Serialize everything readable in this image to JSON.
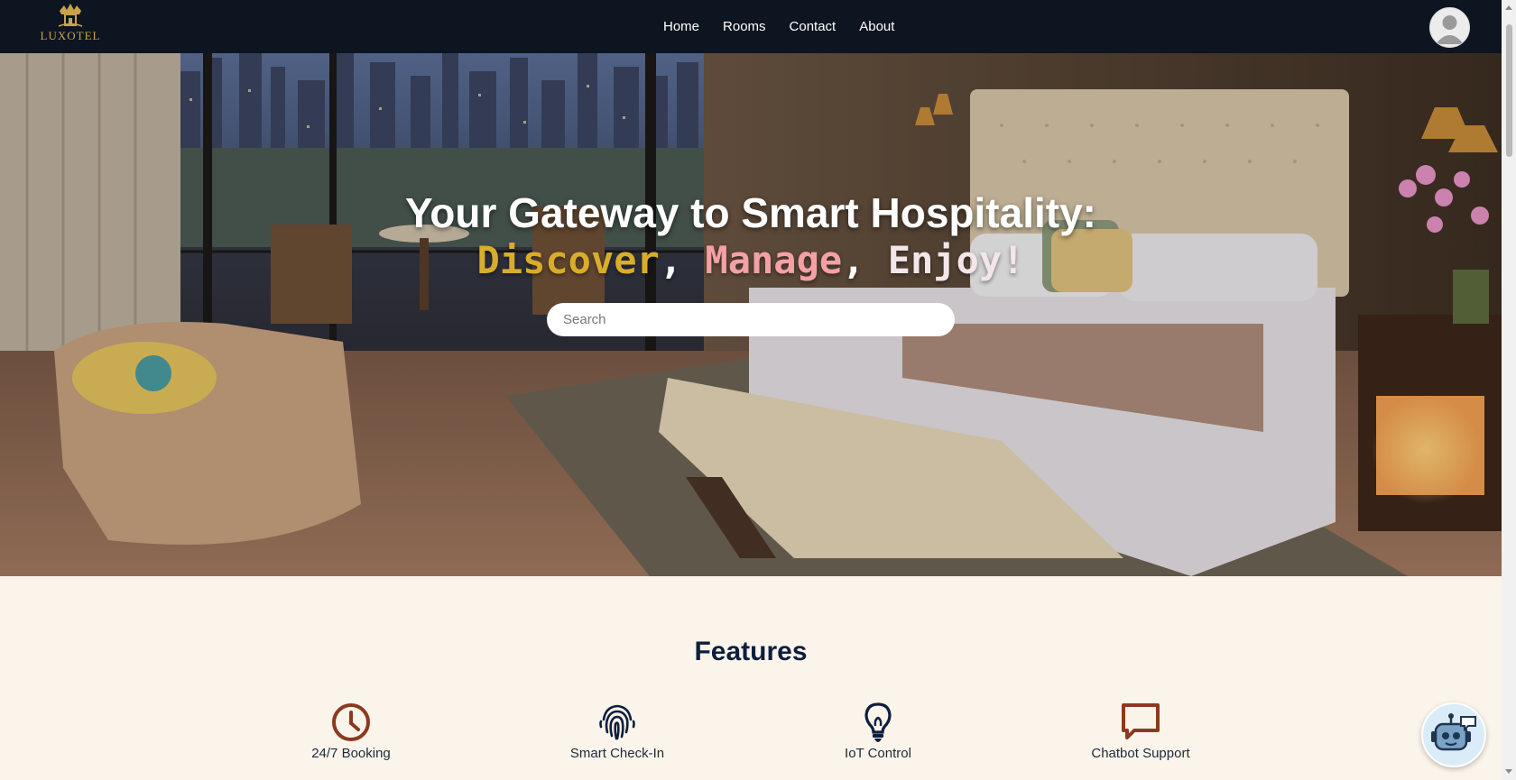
{
  "brand": {
    "name": "LUXOTEL",
    "logo_icon": "crown-hotel-icon"
  },
  "nav": {
    "items": [
      {
        "label": "Home"
      },
      {
        "label": "Rooms"
      },
      {
        "label": "Contact"
      },
      {
        "label": "About"
      }
    ]
  },
  "user": {
    "avatar_icon": "user-avatar-icon"
  },
  "hero": {
    "title": "Your Gateway to Smart Hospitality:",
    "subtitle": {
      "word1": "Discover",
      "sep1": ",",
      "word2": "Manage",
      "sep2": ",",
      "word3": "Enjoy!"
    },
    "search": {
      "placeholder": "Search",
      "value": ""
    }
  },
  "features": {
    "title": "Features",
    "items": [
      {
        "label": "24/7 Booking",
        "icon": "clock-icon"
      },
      {
        "label": "Smart Check-In",
        "icon": "fingerprint-icon"
      },
      {
        "label": "IoT Control",
        "icon": "lightbulb-icon"
      },
      {
        "label": "Chatbot Support",
        "icon": "chat-bubble-icon"
      }
    ]
  },
  "colors": {
    "navbar": "#0d1520",
    "accent_gold": "#d8ad2c",
    "accent_pink": "#f4a0a5",
    "feature_icon_brown": "#8b3a1f",
    "feature_icon_navy": "#0e1f3d",
    "page_background": "#fbf4ea"
  },
  "chatbot": {
    "icon": "robot-chat-icon"
  }
}
